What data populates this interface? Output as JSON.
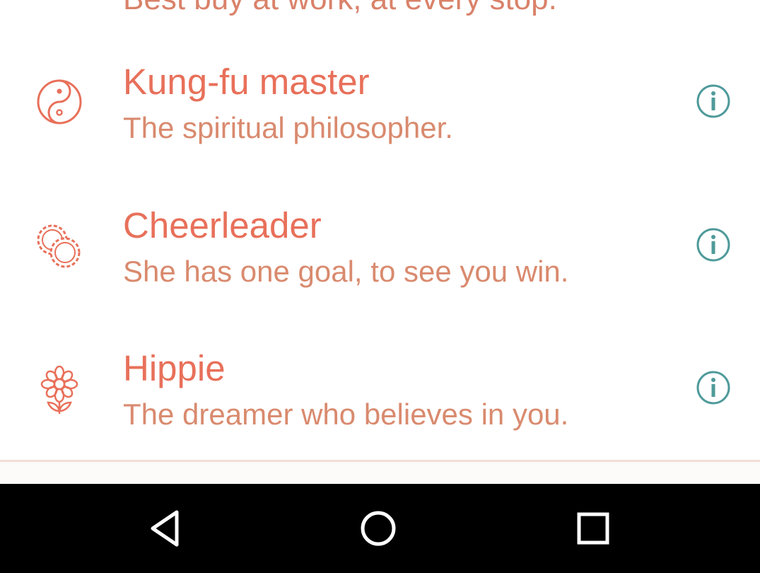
{
  "list": {
    "partial_top_text": "Best buy at work, at every stop.",
    "items": [
      {
        "title": "Kung-fu master",
        "subtitle": "The spiritual philosopher.",
        "icon": "yin-yang-icon"
      },
      {
        "title": "Cheerleader",
        "subtitle": "She has one goal, to see you win.",
        "icon": "pom-poms-icon"
      },
      {
        "title": "Hippie",
        "subtitle": "The dreamer who believes in you.",
        "icon": "flower-icon"
      }
    ],
    "info_icon": "info-icon"
  },
  "navigation": {
    "back": "back-triangle-icon",
    "home": "home-circle-icon",
    "recents": "recents-square-icon"
  },
  "colors": {
    "title": "#e8705a",
    "subtitle": "#d98a6e",
    "info": "#4f9a9a",
    "icon": "#e8705a",
    "nav_bar": "#000000"
  }
}
